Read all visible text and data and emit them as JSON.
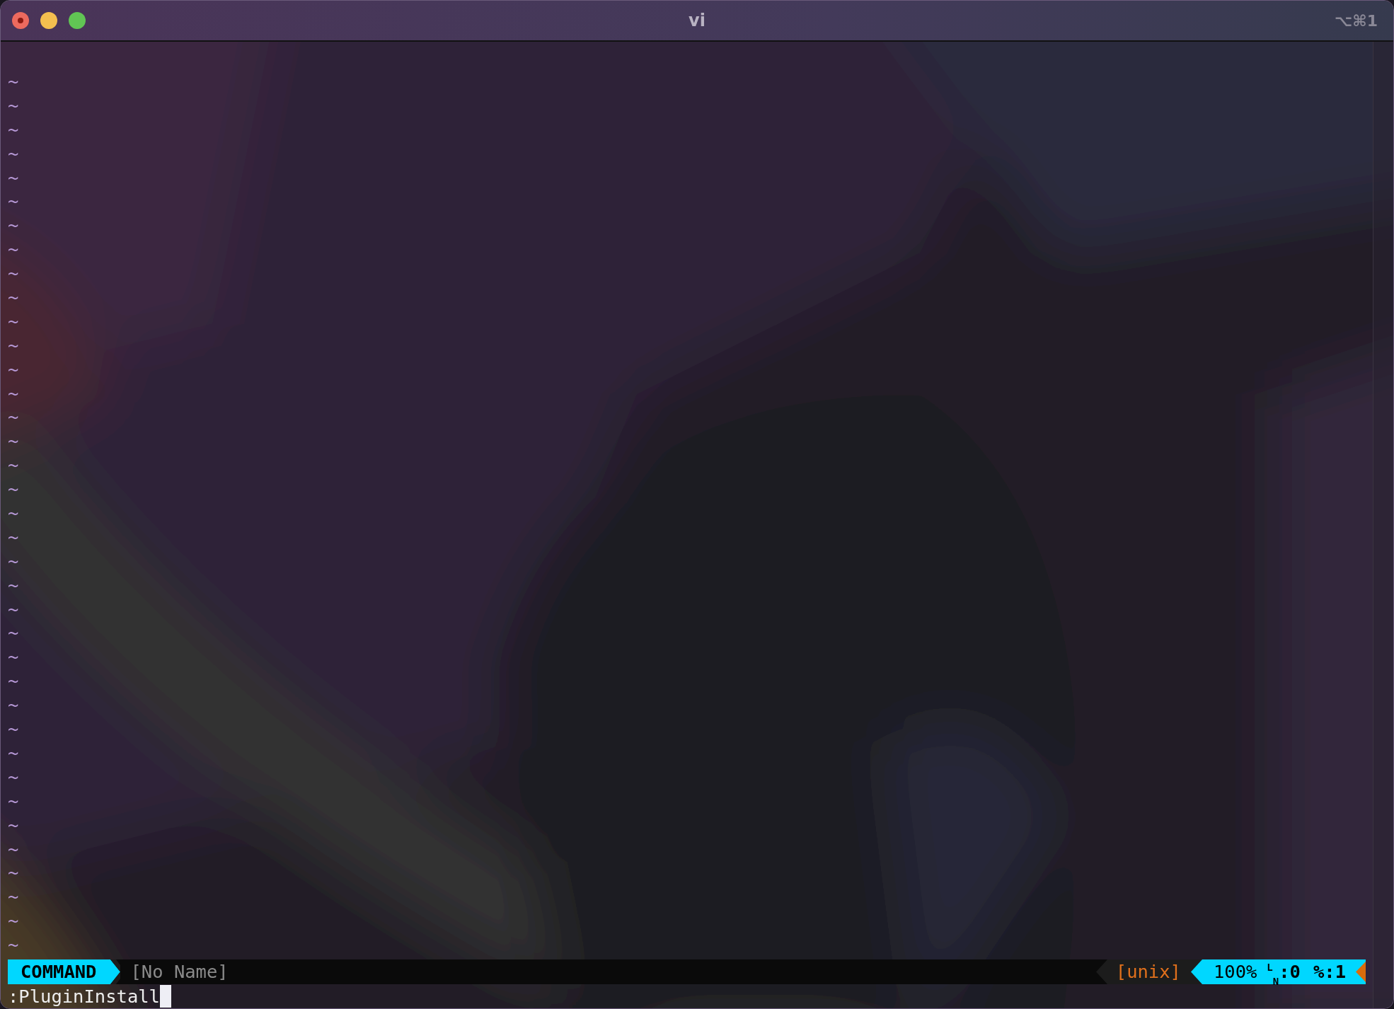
{
  "window": {
    "title": "vi",
    "shortcut": "⌥⌘1"
  },
  "buffer": {
    "empty_lines": [
      "~",
      "~",
      "~",
      "~",
      "~",
      "~",
      "~",
      "~",
      "~",
      "~",
      "~",
      "~",
      "~",
      "~",
      "~",
      "~",
      "~",
      "~",
      "~",
      "~",
      "~",
      "~",
      "~",
      "~",
      "~",
      "~",
      "~",
      "~",
      "~",
      "~",
      "~",
      "~",
      "~",
      "~",
      "~",
      "~",
      "~"
    ]
  },
  "status_line": {
    "mode": "COMMAND",
    "file_name": "[No Name]",
    "file_format": "[unix]",
    "percent": "100%",
    "line_number": "$^{L}$$_{N}$:0",
    "column": "%:1"
  },
  "command_line": {
    "text": ":PluginInstall"
  }
}
